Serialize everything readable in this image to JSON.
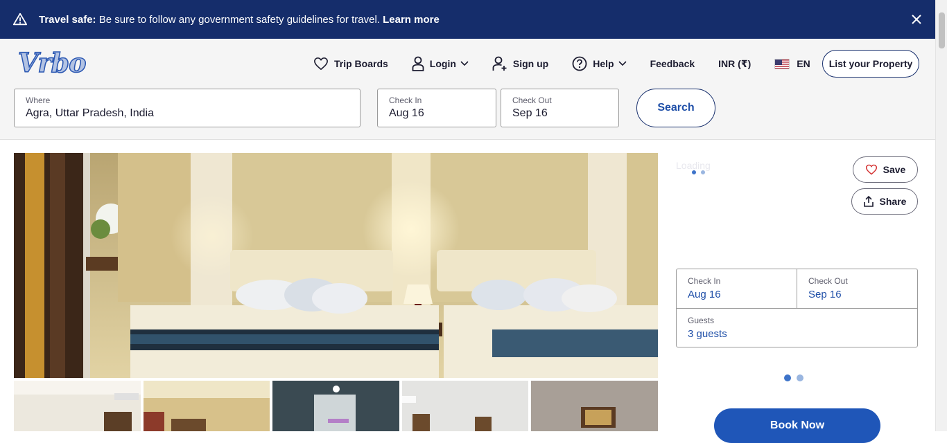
{
  "banner": {
    "title": "Travel safe:",
    "message": " Be sure to follow any government safety guidelines for travel. ",
    "link": "Learn more"
  },
  "header": {
    "logo_text": "Vrbo",
    "nav": {
      "trip_boards": "Trip Boards",
      "login": "Login",
      "sign_up": "Sign up",
      "help": "Help",
      "feedback": "Feedback",
      "currency": "INR (₹)",
      "language": "EN"
    },
    "list_property": "List your Property"
  },
  "search": {
    "where_label": "Where",
    "where_value": "Agra, Uttar Pradesh, India",
    "checkin_label": "Check In",
    "checkin_value": "Aug 16",
    "checkout_label": "Check Out",
    "checkout_value": "Sep 16",
    "button": "Search"
  },
  "panel": {
    "loading": "Loading",
    "save": "Save",
    "share": "Share",
    "checkin_label": "Check In",
    "checkin_value": "Aug 16",
    "checkout_label": "Check Out",
    "checkout_value": "Sep 16",
    "guests_label": "Guests",
    "guests_value": "3 guests",
    "book_now": "Book Now"
  },
  "colors": {
    "brand_navy": "#152d6b",
    "accent_blue": "#1f56b8",
    "link_blue": "#1f4fa8"
  }
}
